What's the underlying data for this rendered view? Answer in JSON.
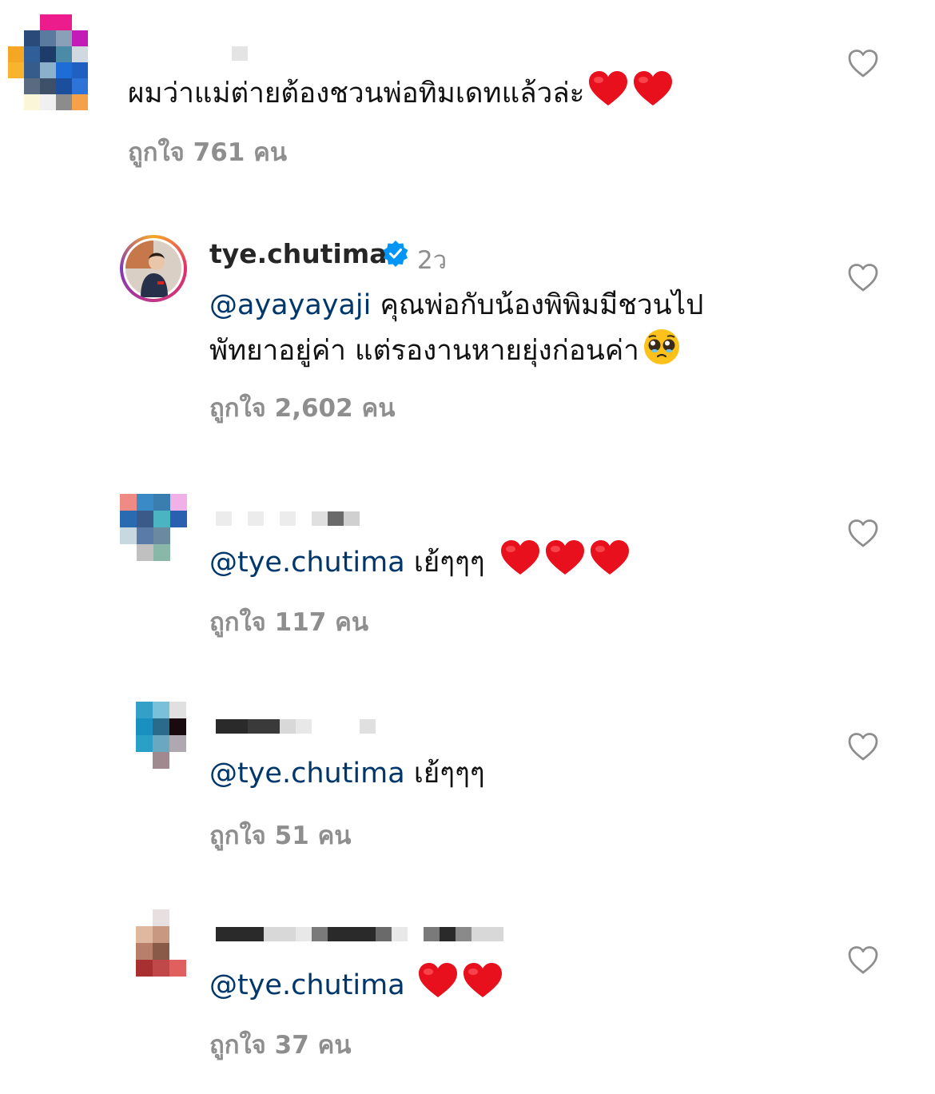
{
  "comments": [
    {
      "text": "ผมว่าแม่ต่ายต้องชวนพ่อทิมเดทแล้วล่ะ",
      "likes": "ถูกใจ 761 คน"
    },
    {
      "username": "tye.chutima",
      "time": "2ว",
      "mention": "@ayayayaji",
      "text_line1": " คุณพ่อกับน้องพิพิมมีชวนไป",
      "text_line2": "พัทยาอยู่ค่า แต่รองานหายยุ่งก่อนค่า",
      "likes": "ถูกใจ 2,602 คน"
    },
    {
      "mention": "@tye.chutima",
      "text": " เย้ๆๆๆ",
      "likes": "ถูกใจ 117 คน"
    },
    {
      "mention": "@tye.chutima",
      "text": " เย้ๆๆๆ",
      "likes": "ถูกใจ 51 คน"
    },
    {
      "mention": "@tye.chutima",
      "text": " ",
      "likes": "ถูกใจ 37 คน"
    }
  ],
  "icons": {
    "like": "heart-outline-icon",
    "verified": "verified-badge-icon",
    "red_heart": "red-heart-emoji",
    "pleading": "pleading-face-emoji"
  },
  "colors": {
    "mention": "#00376b",
    "meta": "#8e8e8e",
    "heart_emoji": "#e8101c",
    "verified": "#0095f6"
  }
}
